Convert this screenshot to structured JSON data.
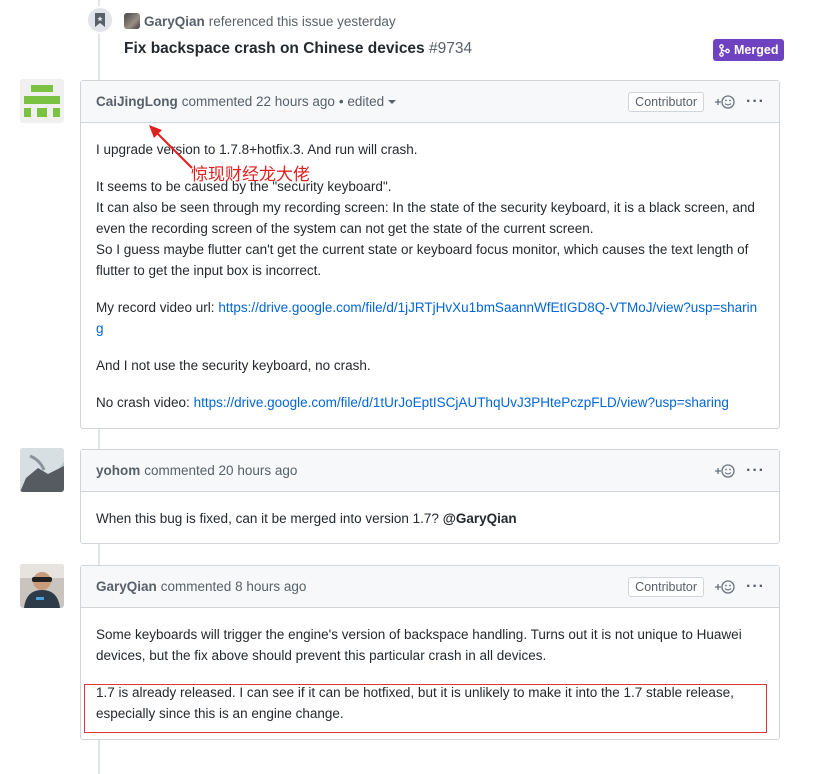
{
  "reference": {
    "user": "GaryQian",
    "text": "referenced this issue yesterday",
    "title": "Fix backspace crash on Chinese devices",
    "number": "#9734",
    "status": "Merged",
    "status_color": "#6f42c1"
  },
  "comments": [
    {
      "author": "CaiJingLong",
      "meta": "commented 22 hours ago",
      "edited": "• edited",
      "badge": "Contributor",
      "paragraphs": [
        "I upgrade version to 1.7.8+hotfix.3. And run will crash.",
        "It seems to be caused by the \"security keyboard\".",
        "It can also be seen through my recording screen: In the state of the security keyboard, it is a black screen, and even the recording screen of the system can not get the state of the current screen.",
        "So I guess maybe flutter can't get the current state or keyboard focus monitor, which causes the text length of flutter to get the input box is incorrect.",
        "My record video url:",
        "https://drive.google.com/file/d/1jJRTjHvXu1bmSaannWfEtIGD8Q-VTMoJ/view?usp=sharing",
        "And I not use the security keyboard, no crash.",
        "No crash video:",
        "https://drive.google.com/file/d/1tUrJoEptISCjAUThqUvJ3PHtePczpFLD/view?usp=sharing"
      ]
    },
    {
      "author": "yohom",
      "meta": "commented 20 hours ago",
      "paragraphs": [
        "When this bug is fixed, can it be merged into version 1.7?",
        "@GaryQian"
      ]
    },
    {
      "author": "GaryQian",
      "meta": "commented 8 hours ago",
      "badge": "Contributor",
      "paragraphs": [
        "Some keyboards will trigger the engine's version of backspace handling. Turns out it is not unique to Huawei devices, but the fix above should prevent this particular crash in all devices.",
        "1.7 is already released. I can see if it can be hotfixed, but it is unlikely to make it into the 1.7 stable release, especially since this is an engine change."
      ]
    }
  ],
  "annotation": "惊现财经龙大佬",
  "icons": {
    "reference": "bookmark-icon",
    "merged": "git-merge-icon",
    "reaction": "add-reaction-icon",
    "more": "kebab-icon"
  }
}
